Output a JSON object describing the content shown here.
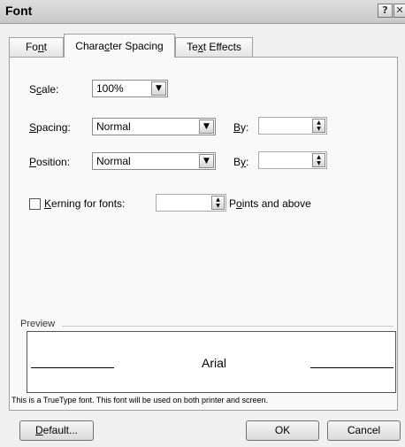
{
  "window": {
    "title": "Font",
    "help_glyph": "?",
    "close_glyph": "✕"
  },
  "tabs": [
    {
      "pre": "Fo",
      "key": "n",
      "post": "t"
    },
    {
      "pre": "Chara",
      "key": "c",
      "post": "ter Spacing"
    },
    {
      "pre": "Te",
      "key": "x",
      "post": "t Effects"
    }
  ],
  "scale": {
    "pre": "S",
    "key": "c",
    "post": "ale:",
    "value": "100%"
  },
  "spacing": {
    "key": "S",
    "post": "pacing:",
    "value": "Normal",
    "by_key": "B",
    "by_post": "y:",
    "by_value": ""
  },
  "position": {
    "key": "P",
    "post": "osition:",
    "value": "Normal",
    "by_pre": "B",
    "by_key": "y",
    "by_post": ":",
    "by_value": ""
  },
  "kerning": {
    "key": "K",
    "post": "erning for fonts:",
    "value": "",
    "points_pre": "P",
    "points_key": "o",
    "points_post": "ints and above"
  },
  "preview": {
    "label": "Preview",
    "sample": "Arial"
  },
  "info_text": "This is a TrueType font. This font will be used on both printer and screen.",
  "buttons": {
    "default_key": "D",
    "default_post": "efault...",
    "ok": "OK",
    "cancel": "Cancel"
  }
}
